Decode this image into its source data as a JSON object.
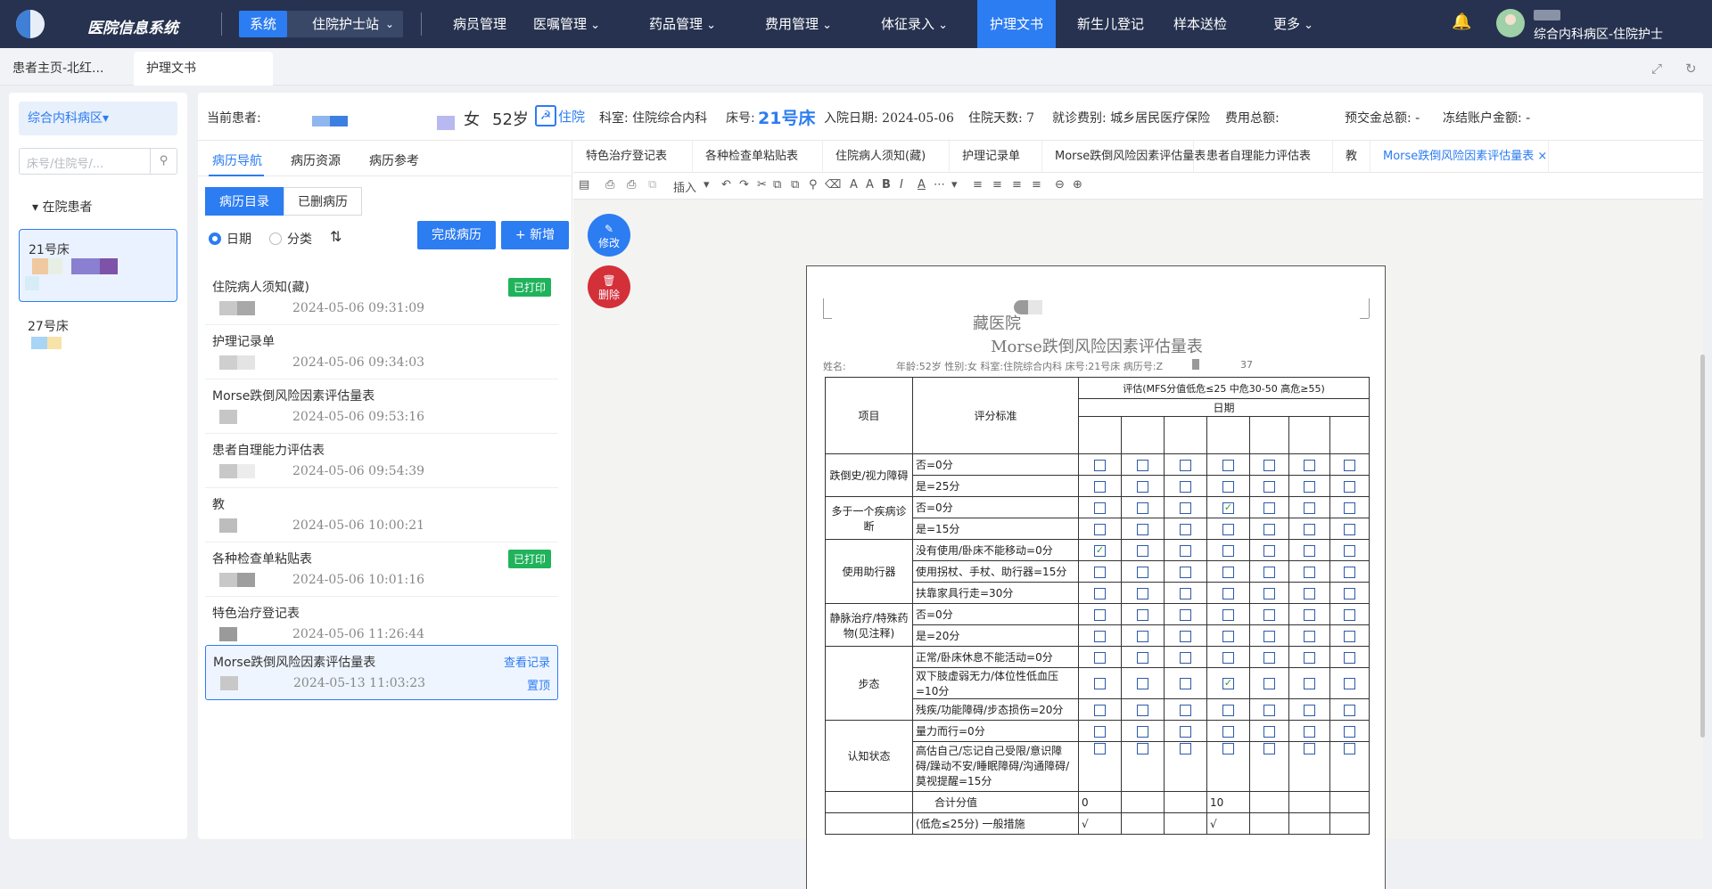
{
  "app": {
    "title": "医院信息系统",
    "system_tag": "系统",
    "station": "住院护士站",
    "user_ward": "综合内科病区-住院护士"
  },
  "nav": [
    {
      "label": "病员管理",
      "dd": false
    },
    {
      "label": "医嘱管理",
      "dd": true
    },
    {
      "label": "药品管理",
      "dd": true
    },
    {
      "label": "费用管理",
      "dd": true
    },
    {
      "label": "体征录入",
      "dd": true
    },
    {
      "label": "护理文书",
      "dd": false,
      "active": true
    },
    {
      "label": "新生儿登记",
      "dd": false
    },
    {
      "label": "样本送检",
      "dd": false
    },
    {
      "label": "更多",
      "dd": true
    }
  ],
  "page_tabs": [
    "患者主页-北红...",
    "护理文书"
  ],
  "left": {
    "ward": "综合内科病区▾",
    "search_placeholder": "床号/住院号/...",
    "section": "▾  在院患者",
    "beds": [
      "21号床",
      "27号床"
    ]
  },
  "patient": {
    "label": "当前患者:",
    "sex": "女",
    "age": "52岁",
    "status": "住院",
    "dept": "科室: 住院综合内科",
    "bed_label": "床号:",
    "bed": "21号床",
    "admit": "入院日期: 2024-05-06",
    "days": "住院天数: 7",
    "insurance": "就诊费别: 城乡居民医疗保险",
    "total": "费用总额:",
    "prepay": "预交金总额: -",
    "frozen": "冻结账户金额: -"
  },
  "record_nav": {
    "tabs": [
      "病历导航",
      "病历资源",
      "病历参考"
    ],
    "seg": [
      "病历目录",
      "已删病历"
    ],
    "radio": [
      "日期",
      "分类"
    ],
    "complete_btn": "完成病历",
    "new_btn": "+ 新增",
    "items": [
      {
        "name": "住院病人须知(藏)",
        "time": "2024-05-06 09:31:09",
        "badge": "已打印"
      },
      {
        "name": "护理记录单",
        "time": "2024-05-06 09:34:03",
        "badge": ""
      },
      {
        "name": "Morse跌倒风险因素评估量表",
        "time": "2024-05-06 09:53:16",
        "badge": ""
      },
      {
        "name": "患者自理能力评估表",
        "time": "2024-05-06 09:54:39",
        "badge": ""
      },
      {
        "name": "教",
        "time": "2024-05-06 10:00:21",
        "badge": ""
      },
      {
        "name": "各种检查单粘贴表",
        "time": "2024-05-06 10:01:16",
        "badge": "已打印"
      },
      {
        "name": "特色治疗登记表",
        "time": "2024-05-06 11:26:44",
        "badge": ""
      }
    ],
    "selected": {
      "name": "Morse跌倒风险因素评估量表",
      "time": "2024-05-13 11:03:23",
      "view": "查看记录",
      "top": "置顶"
    }
  },
  "doc_tabs": [
    "特色治疗登记表",
    "各种检查单粘贴表",
    "住院病人须知(藏)",
    "护理记录单",
    "Morse跌倒风险因素评估量表",
    "患者自理能力评估表",
    "教",
    "Morse跌倒风险因素评估量表"
  ],
  "toolbar": {
    "insert": "插入"
  },
  "actions": {
    "edit": "修改",
    "delete": "删除"
  },
  "form": {
    "hospital": "藏医院",
    "title": "Morse跌倒风险因素评估量表",
    "name_label": "姓名:",
    "meta": "年龄:52岁  性别:女   科室:住院综合内科  床号:21号床  病历号:Z",
    "mrn_tail": "37",
    "h_item": "项目",
    "h_std": "评分标准",
    "h_eval": "评估(MFS分值低危≤25 中危30-50 高危≥55)",
    "h_date": "日期",
    "groups": [
      {
        "item": "跌倒史/视力障碍",
        "rows": [
          {
            "std": "否=0分",
            "checks": [
              0,
              0,
              0,
              0,
              0,
              0,
              0
            ]
          },
          {
            "std": "是=25分",
            "checks": [
              0,
              0,
              0,
              0,
              0,
              0,
              0
            ]
          }
        ]
      },
      {
        "item": "多于一个疾病诊断",
        "rows": [
          {
            "std": "否=0分",
            "checks": [
              0,
              0,
              0,
              1,
              0,
              0,
              0
            ]
          },
          {
            "std": "是=15分",
            "checks": [
              0,
              0,
              0,
              0,
              0,
              0,
              0
            ]
          }
        ]
      },
      {
        "item": "使用助行器",
        "rows": [
          {
            "std": "没有使用/卧床不能移动=0分",
            "checks": [
              1,
              0,
              0,
              0,
              0,
              0,
              0
            ]
          },
          {
            "std": "使用拐杖、手杖、助行器=15分",
            "checks": [
              0,
              0,
              0,
              0,
              0,
              0,
              0
            ]
          },
          {
            "std": "扶靠家具行走=30分",
            "checks": [
              0,
              0,
              0,
              0,
              0,
              0,
              0
            ]
          }
        ]
      },
      {
        "item": "静脉治疗/特殊药物(见注释)",
        "rows": [
          {
            "std": "否=0分",
            "checks": [
              0,
              0,
              0,
              0,
              0,
              0,
              0
            ]
          },
          {
            "std": "是=20分",
            "checks": [
              0,
              0,
              0,
              0,
              0,
              0,
              0
            ]
          }
        ]
      },
      {
        "item": "步态",
        "rows": [
          {
            "std": "正常/卧床休息不能活动=0分",
            "checks": [
              0,
              0,
              0,
              0,
              0,
              0,
              0
            ]
          },
          {
            "std": "双下肢虚弱无力/体位性低血压=10分",
            "checks": [
              0,
              0,
              0,
              1,
              0,
              0,
              0
            ]
          },
          {
            "std": "残疾/功能障碍/步态损伤=20分",
            "checks": [
              0,
              0,
              0,
              0,
              0,
              0,
              0
            ]
          }
        ]
      },
      {
        "item": "认知状态",
        "rows": [
          {
            "std": "量力而行=0分",
            "checks": [
              0,
              0,
              0,
              0,
              0,
              0,
              0
            ]
          },
          {
            "std": "高估自己/忘记自己受限/意识障碍/躁动不安/睡眠障碍/沟通障碍/莫视提醒=15分",
            "checks": [
              0,
              0,
              0,
              0,
              0,
              0,
              0
            ]
          }
        ]
      }
    ],
    "total_label": "合计分值",
    "totals": [
      "0",
      "",
      "",
      "10",
      "",
      "",
      ""
    ],
    "measure_label": "(低危≤25分) 一般措施",
    "measures": [
      "√",
      "",
      "",
      "√",
      "",
      "",
      ""
    ]
  }
}
